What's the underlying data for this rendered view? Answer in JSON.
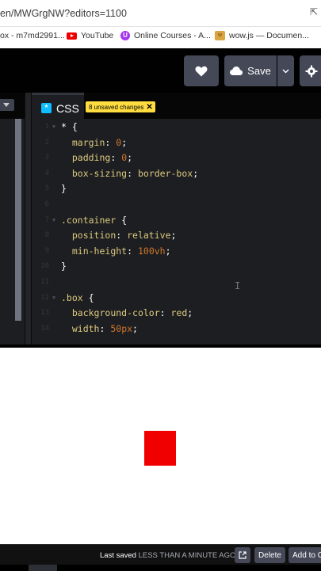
{
  "browser": {
    "url": "en/MWGrgNW?editors=1100",
    "bookmarks": [
      {
        "label": "ox - m7md2991..."
      },
      {
        "label": "YouTube"
      },
      {
        "label": "Online Courses - A..."
      },
      {
        "label": "wow.js — Documen..."
      }
    ]
  },
  "header": {
    "save_label": "Save"
  },
  "editor": {
    "tab_title": "CSS",
    "unsaved_label": "8 unsaved changes",
    "line_numbers": [
      "1",
      "2",
      "3",
      "4",
      "5",
      "6",
      "7",
      "8",
      "9",
      "10",
      "11",
      "12",
      "13",
      "14"
    ],
    "code": {
      "l1_sel": "* ",
      "l1_brace": "{",
      "l2_prop": "margin",
      "l2_val": "0",
      "l3_prop": "padding",
      "l3_val": "0",
      "l4_prop": "box-sizing",
      "l4_val": "border-box",
      "l5": "}",
      "l7_sel": ".container ",
      "l7_brace": "{",
      "l8_prop": "position",
      "l8_val": "relative",
      "l9_prop": "min-height",
      "l9_val": "100vh",
      "l10": "}",
      "l12_sel": ".box ",
      "l12_brace": "{",
      "l13_prop": "background-color",
      "l13_val": "red",
      "l14_prop": "width",
      "l14_val": "50px"
    }
  },
  "preview": {
    "box_color": "#f00000"
  },
  "footer": {
    "last_saved_prefix": "Last saved ",
    "last_saved_time": "LESS THAN A MINUTE AGO",
    "delete_label": "Delete",
    "add_to_label": "Add to C"
  }
}
